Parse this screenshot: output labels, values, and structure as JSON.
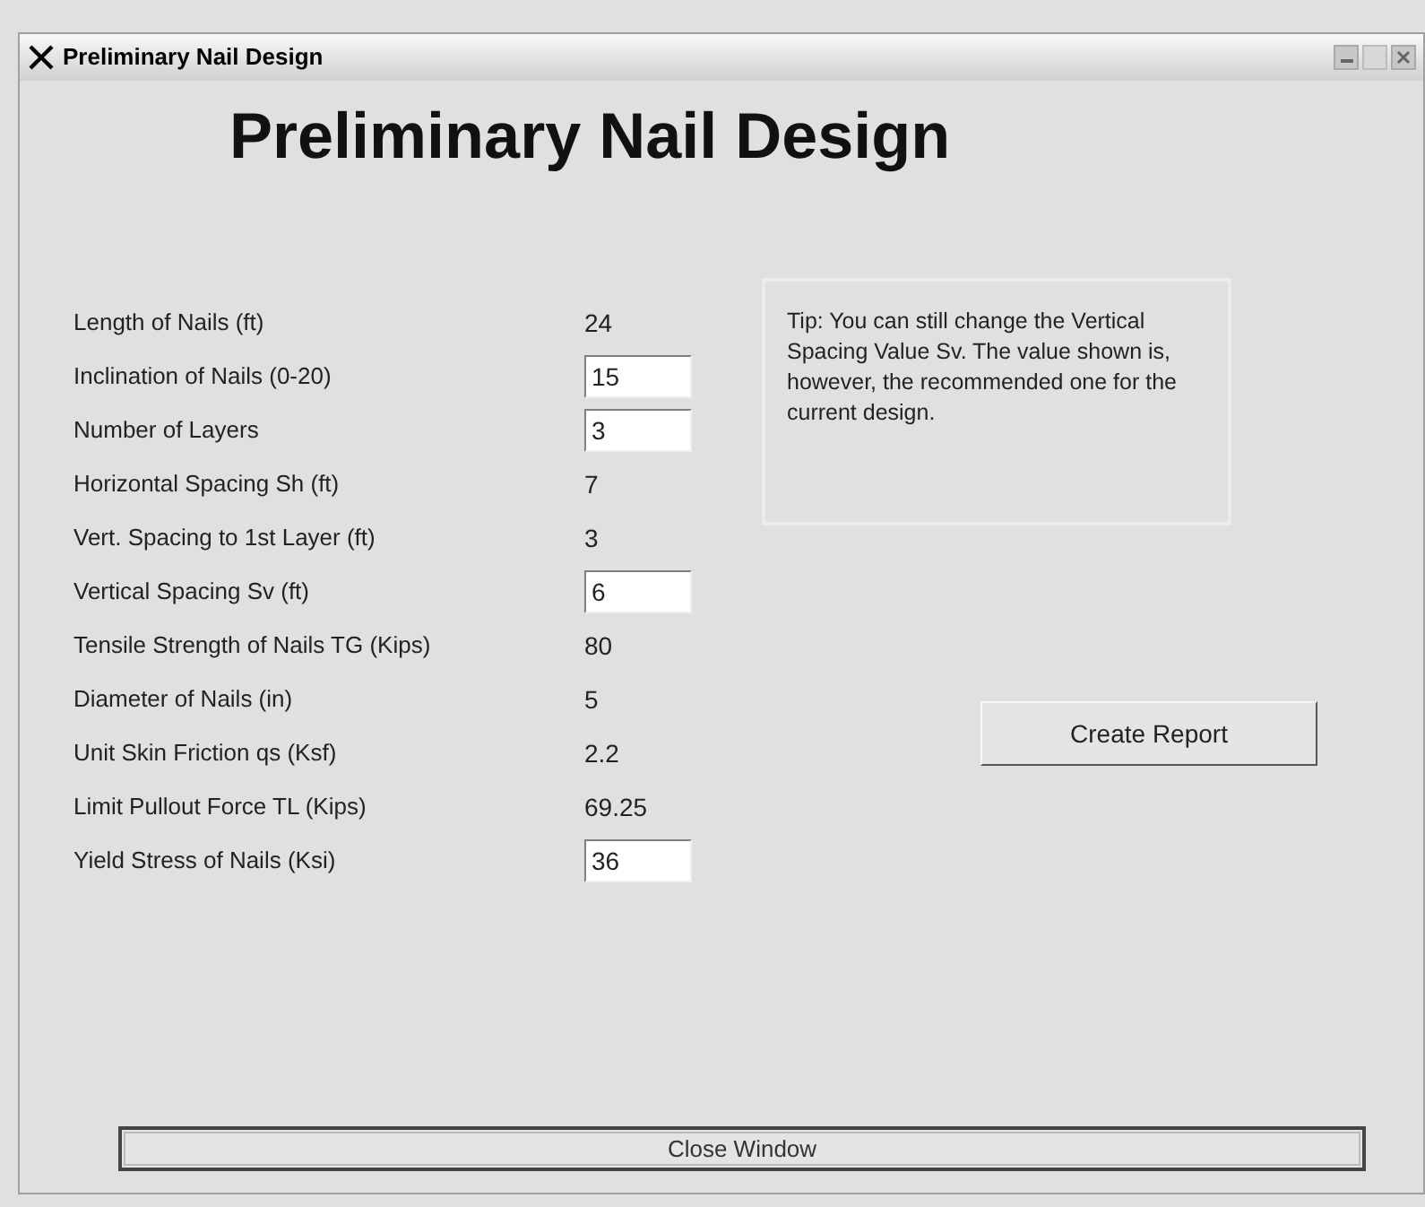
{
  "window": {
    "title": "Preliminary Nail Design"
  },
  "heading": "Preliminary Nail Design",
  "fields": [
    {
      "label": "Length of Nails (ft)",
      "kind": "value",
      "value": "24"
    },
    {
      "label": "Inclination of Nails (0-20)",
      "kind": "input",
      "value": "15"
    },
    {
      "label": "Number of Layers",
      "kind": "input",
      "value": "3"
    },
    {
      "label": "Horizontal Spacing Sh (ft)",
      "kind": "value",
      "value": "7"
    },
    {
      "label": "Vert. Spacing to 1st Layer (ft)",
      "kind": "value",
      "value": "3"
    },
    {
      "label": "Vertical Spacing Sv (ft)",
      "kind": "input",
      "value": "6"
    },
    {
      "label": "Tensile Strength of Nails TG (Kips)",
      "kind": "value",
      "value": "80"
    },
    {
      "label": "Diameter of Nails (in)",
      "kind": "value",
      "value": "5"
    },
    {
      "label": "Unit Skin Friction qs (Ksf)",
      "kind": "value",
      "value": "2.2"
    },
    {
      "label": "Limit Pullout Force TL (Kips)",
      "kind": "value",
      "value": "69.25"
    },
    {
      "label": "Yield Stress of Nails (Ksi)",
      "kind": "input",
      "value": "36"
    }
  ],
  "tip": "Tip: You can still change the Vertical Spacing Value Sv. The value shown is, however, the recommended one for the current design.",
  "buttons": {
    "create_report": "Create Report",
    "close_window": "Close Window"
  }
}
